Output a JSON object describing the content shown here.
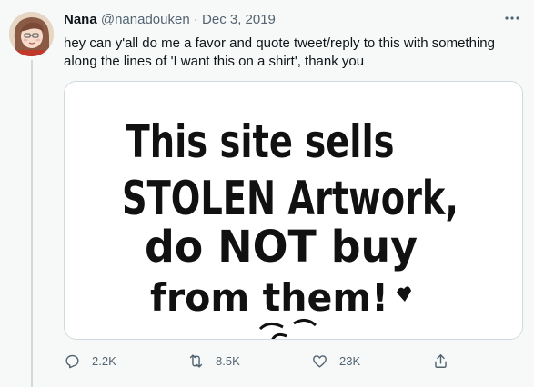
{
  "tweet": {
    "author_name": "Nana",
    "author_handle": "@nanadouken",
    "separator": "·",
    "date": "Dec 3, 2019",
    "text": "hey can y'all do me a favor and quote tweet/reply to this with something along the lines of 'I want this on a shirt', thank you",
    "image_text": {
      "line1": "This site sells",
      "line2": "STOLEN Artwork,",
      "line3": "do NOT buy",
      "line4": "from them!"
    }
  },
  "actions": {
    "reply_count": "2.2K",
    "retweet_count": "8.5K",
    "like_count": "23K"
  },
  "icons": {
    "more": "more-horizontal-icon",
    "reply": "reply-icon",
    "retweet": "retweet-icon",
    "like": "heart-icon",
    "share": "share-icon"
  },
  "colors": {
    "background": "#f7f9f9",
    "secondary_text": "#536471",
    "border": "#cfd9de"
  }
}
